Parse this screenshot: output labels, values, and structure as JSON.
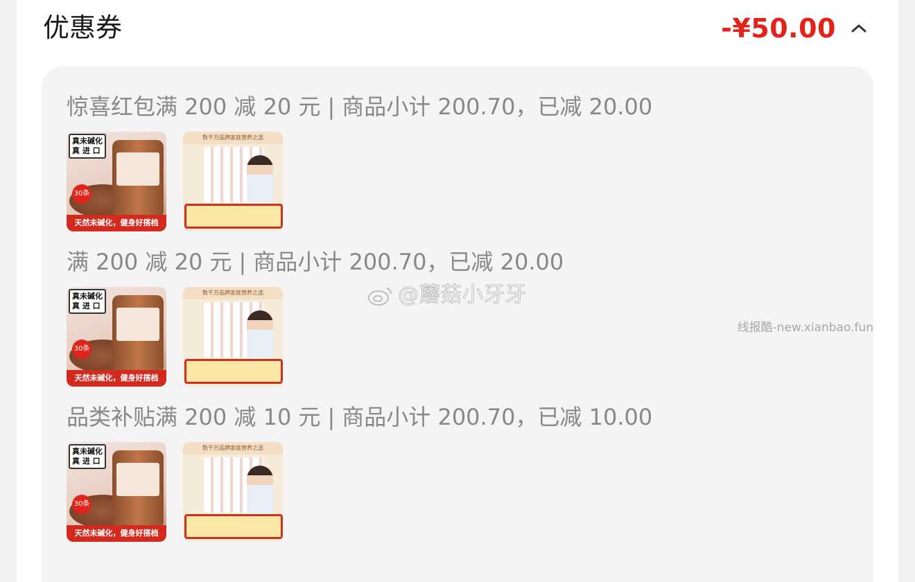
{
  "header": {
    "title": "优惠券",
    "amount": "-¥50.00",
    "toggle_icon": "chevron-up-icon"
  },
  "groups": [
    {
      "prefix": "惊喜红包满 200 减 20 元",
      "divider": "|",
      "suffix": "商品小计 200.70，已减 20.00"
    },
    {
      "prefix": "满 200 减 20 元",
      "divider": "|",
      "suffix": "商品小计 200.70，已减 20.00"
    },
    {
      "prefix": "品类补贴满 200 减 10 元",
      "divider": "|",
      "suffix": "商品小计 200.70，已减 10.00"
    }
  ],
  "product_cocoa": {
    "tag": "真未碱化\n真 进 口",
    "badge": "30条",
    "strip": "天然未碱化，健身好搭档"
  },
  "product_milk": {
    "top": "数千万品牌家庭营养之选"
  },
  "watermark": "@蘑菇小牙牙",
  "watermark_site": "线报酷-new.xianbao.fun",
  "colors": {
    "accent": "#e2231a",
    "panel": "#f4f4f4",
    "muted_text": "#888888"
  }
}
